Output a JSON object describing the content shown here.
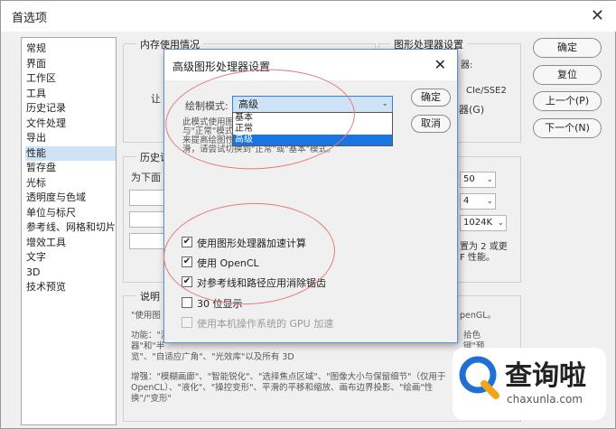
{
  "window": {
    "title": "首选项",
    "close_glyph": "✕"
  },
  "categories": [
    "常规",
    "界面",
    "工作区",
    "工具",
    "历史记录",
    "文件处理",
    "导出",
    "性能",
    "暂存盘",
    "光标",
    "透明度与色域",
    "单位与标尺",
    "参考线、网格和切片",
    "增效工具",
    "文字",
    "3D",
    "技术预览"
  ],
  "selected_category": "性能",
  "buttons": {
    "ok": "确定",
    "reset": "复位",
    "prev": "上一个(P)",
    "next": "下一个(N)"
  },
  "groups": {
    "memory": "内存使用情况",
    "gpu": "图形处理器设置",
    "history": "历史记",
    "description": "说明"
  },
  "background_text": {
    "memory_let": "让",
    "gpu_frag1": "器:",
    "gpu_frag2": "CIe/SSE2",
    "gpu_frag3": "器(G)",
    "history_sub": "为下面",
    "field1": "50",
    "field2": "4",
    "field3": "1024K",
    "hist_note1": "置为 2 或更",
    "hist_note2": "F 性能。",
    "desc1": "\"使用图",
    "desc1b": "penGL。",
    "desc2": "功能：\"渲",
    "desc2b": "拾色",
    "desc3": "器\"和\"半",
    "desc3b": "键\"预",
    "desc4": "览\"、\"自适应广角\"、\"光效库\"以及所有 3D",
    "desc5": "增强：\"模糊画廊\"、\"智能锐化\"、\"选择焦点区域\"、\"图像大小与保留细节\"（仅用于",
    "desc6": "OpenCL）、\"液化\"、\"操控变形\"、平滑的平移和缩放、画布边界投影、\"绘画\"性",
    "desc7": "换\"/\"变形\""
  },
  "dialog": {
    "title": "高级图形处理器设置",
    "close_glyph": "✕",
    "ok": "确定",
    "cancel": "取消",
    "mode_label": "绘制模式:",
    "mode_value": "高级",
    "mode_options": [
      "基本",
      "正常",
      "高级"
    ],
    "mode_highlighted": "高级",
    "desc_lines": [
      "此模式使用图",
      "与\"正常\"模式",
      "来提高绘图性",
      "滑，请尝试切换到\"正常\"或\"基本\"模式。"
    ],
    "checkboxes": [
      {
        "label": "使用图形处理器加速计算",
        "checked": true,
        "enabled": true
      },
      {
        "label": "使用 OpenCL",
        "checked": true,
        "enabled": true
      },
      {
        "label": "对参考线和路径应用消除锯齿",
        "checked": true,
        "enabled": true
      },
      {
        "label": "30 位显示",
        "checked": false,
        "enabled": true
      },
      {
        "label": "使用本机操作系统的 GPU 加速",
        "checked": false,
        "enabled": false
      }
    ]
  },
  "watermark": {
    "text": "查询啦",
    "sub": "chaxunla.com"
  },
  "colors": {
    "highlight": "#1a74e2",
    "annotation": "#e7787a",
    "accent_select": "#cfe3f7",
    "watermark_blue": "#1f6fd6"
  },
  "icons": [
    "close-icon",
    "dropdown-arrow-icon",
    "checkmark-icon",
    "search-logo-icon"
  ]
}
